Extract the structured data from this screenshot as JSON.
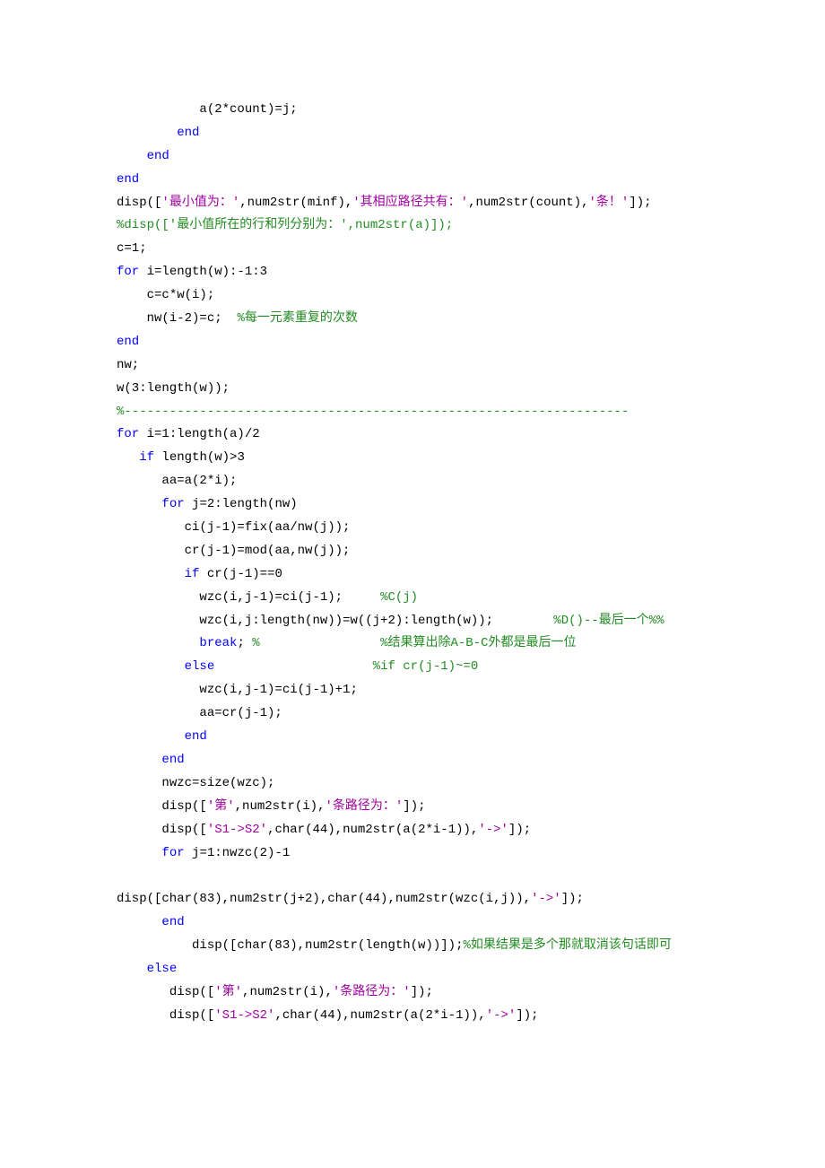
{
  "code": {
    "l01": "           a(2*count)=j;",
    "l02_kw": "        end",
    "l03_kw": "    end",
    "l04_kw": "end",
    "l05_a": "disp([",
    "l05_s1": "'最小值为：'",
    "l05_b": ",num2str(minf),",
    "l05_s2": "'其相应路径共有：'",
    "l05_c": ",num2str(count),",
    "l05_s3": "'条！'",
    "l05_d": "]);",
    "l06_com": "%disp(['最小值所在的行和列分别为：',num2str(a)]);",
    "l07": "c=1;",
    "l08_kw": "for",
    "l08_b": " i=length(w):-1:3",
    "l09": "    c=c*w(i);",
    "l10_a": "    nw(i-2)=c;  ",
    "l10_com": "%每一元素重复的次数",
    "l11_kw": "end",
    "l12": "nw;",
    "l13": "w(3:length(w));",
    "l14_com": "%-------------------------------------------------------------------",
    "l15_kw": "for",
    "l15_b": " i=1:length(a)/2",
    "l16_a": "   ",
    "l16_kw": "if",
    "l16_b": " length(w)>3",
    "l17": "      aa=a(2*i);",
    "l18_a": "      ",
    "l18_kw": "for",
    "l18_b": " j=2:length(nw)",
    "l19": "         ci(j-1)=fix(aa/nw(j));",
    "l20": "         cr(j-1)=mod(aa,nw(j));",
    "l21_a": "         ",
    "l21_kw": "if",
    "l21_b": " cr(j-1)==0",
    "l22_a": "           wzc(i,j-1)=ci(j-1);     ",
    "l22_com": "%C(j)",
    "l23_a": "           wzc(i,j:length(nw))=w((j+2):length(w));        ",
    "l23_com": "%D()--最后一个%%",
    "l24_a": "           ",
    "l24_kw": "break",
    "l24_b": "; ",
    "l24_com": "%                %结果算出除A-B-C外都是最后一位",
    "l25_a": "         ",
    "l25_kw": "else",
    "l25_com": "                     %if cr(j-1)~=0",
    "l26": "           wzc(i,j-1)=ci(j-1)+1;",
    "l27": "           aa=cr(j-1);",
    "l28_a": "         ",
    "l28_kw": "end",
    "l29_a": "      ",
    "l29_kw": "end",
    "l30": "      nwzc=size(wzc);",
    "l31_a": "      disp([",
    "l31_s1": "'第'",
    "l31_b": ",num2str(i),",
    "l31_s2": "'条路径为：'",
    "l31_c": "]);",
    "l32_a": "      disp([",
    "l32_s1": "'S1->S2'",
    "l32_b": ",char(44),num2str(a(2*i-1)),",
    "l32_s2": "'->'",
    "l32_c": "]);",
    "l33_a": "      ",
    "l33_kw": "for",
    "l33_b": " j=1:nwzc(2)-1",
    "l34": " ",
    "l35_a": "disp([char(83),num2str(j+2),char(44),num2str(wzc(i,j)),",
    "l35_s1": "'->'",
    "l35_b": "]);",
    "l36_a": "      ",
    "l36_kw": "end",
    "l37_a": "          disp([char(83),num2str(length(w))]);",
    "l37_com": "%如果结果是多个那就取消该句话即可",
    "l38_a": "    ",
    "l38_kw": "else",
    "l39_a": "       disp([",
    "l39_s1": "'第'",
    "l39_b": ",num2str(i),",
    "l39_s2": "'条路径为：'",
    "l39_c": "]);",
    "l40_a": "       disp([",
    "l40_s1": "'S1->S2'",
    "l40_b": ",char(44),num2str(a(2*i-1)),",
    "l40_s2": "'->'",
    "l40_c": "]);"
  }
}
